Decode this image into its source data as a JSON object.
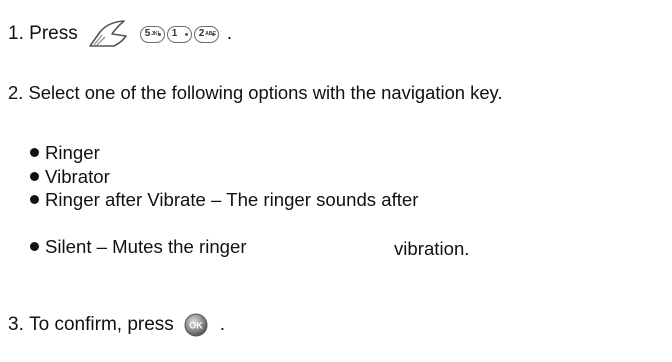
{
  "steps": [
    {
      "number": "1.",
      "text": "Press",
      "trail": "."
    },
    {
      "number": "2.",
      "text": "Select one of the following options with the navigation key."
    },
    {
      "number": "3.",
      "text": "To confirm, press",
      "trail": "."
    }
  ],
  "keys": [
    {
      "icon": "menu-key-icon"
    },
    {
      "icon": "key-5-icon",
      "digit": "5",
      "letters": "JKL"
    },
    {
      "icon": "key-1-icon",
      "digit": "1",
      "letters": ""
    },
    {
      "icon": "key-2-icon",
      "digit": "2",
      "letters": "ABC"
    }
  ],
  "options": [
    {
      "label": "Ringer"
    },
    {
      "label": "Vibrator"
    },
    {
      "label": "Ringer after Vibrate – The ringer sounds after",
      "continuation": "vibration."
    },
    {
      "label": "Silent – Mutes the ringer"
    }
  ],
  "ok_key": {
    "icon": "ok-key-icon",
    "label": "OK"
  }
}
